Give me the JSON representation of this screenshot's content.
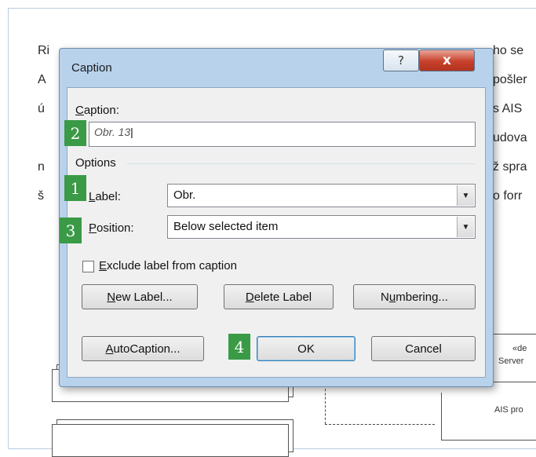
{
  "document": {
    "lines": [
      {
        "left": "Ri",
        "right": "ho se"
      },
      {
        "left": "A",
        "right": "pošler"
      },
      {
        "left": "ú",
        "right": "s AIS"
      },
      {
        "left": "",
        "right": "udova"
      },
      {
        "left": "n",
        "right": "ž spra"
      },
      {
        "left": "š",
        "right": "o forr"
      }
    ],
    "diagram": {
      "server_box_line1": "«de",
      "server_box_line2": "Server",
      "ais_box": "AIS pro"
    }
  },
  "dialog": {
    "title": "Caption",
    "help_glyph": "?",
    "close_glyph": "x",
    "caption_label": "Caption:",
    "caption_value": "Obr. 13",
    "options_label": "Options",
    "label_label": "Label:",
    "label_value": "Obr.",
    "position_label": "Position:",
    "position_value": "Below selected item",
    "exclude_label": "Exclude label from caption",
    "exclude_checked": false,
    "buttons": {
      "new_label": "New Label...",
      "delete_label": "Delete Label",
      "numbering": "Numbering...",
      "autocaption": "AutoCaption...",
      "ok": "OK",
      "cancel": "Cancel"
    }
  },
  "badges": [
    "1",
    "2",
    "3",
    "4"
  ],
  "colors": {
    "badge_green": "#3a9a46",
    "dialog_frame": "#b8d2ec",
    "close_red": "#c7402b"
  }
}
